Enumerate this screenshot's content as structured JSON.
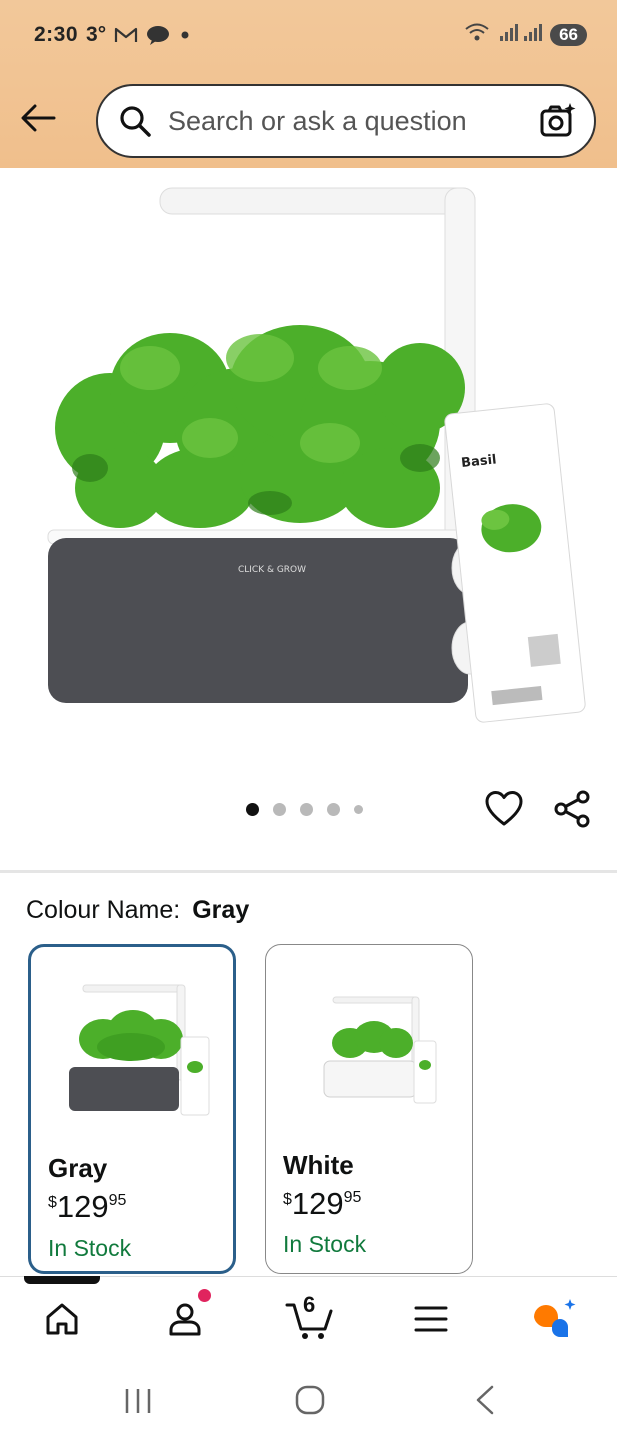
{
  "status_bar": {
    "time": "2:30",
    "temp": "3°",
    "battery": "66"
  },
  "header": {
    "search_placeholder": "Search or ask a question"
  },
  "gallery": {
    "image_count": 5,
    "active_index": 0
  },
  "variation": {
    "label": "Colour Name:",
    "selected_value": "Gray",
    "options": [
      {
        "name": "Gray",
        "price_symbol": "$",
        "price_whole": "129",
        "price_fraction": "95",
        "stock": "In Stock"
      },
      {
        "name": "White",
        "price_symbol": "$",
        "price_whole": "129",
        "price_fraction": "95",
        "stock": "In Stock"
      }
    ]
  },
  "bottom_nav": {
    "cart_count": "6",
    "items": [
      "home-icon",
      "account-icon",
      "cart-icon",
      "menu-icon",
      "rufus-icon"
    ]
  },
  "colors": {
    "header_bg": "#f0bf8c",
    "selected_border": "#2b5f8a",
    "in_stock": "#117a3d",
    "notification_dot": "#e0245e",
    "planter_gray": "#4d4e53"
  }
}
